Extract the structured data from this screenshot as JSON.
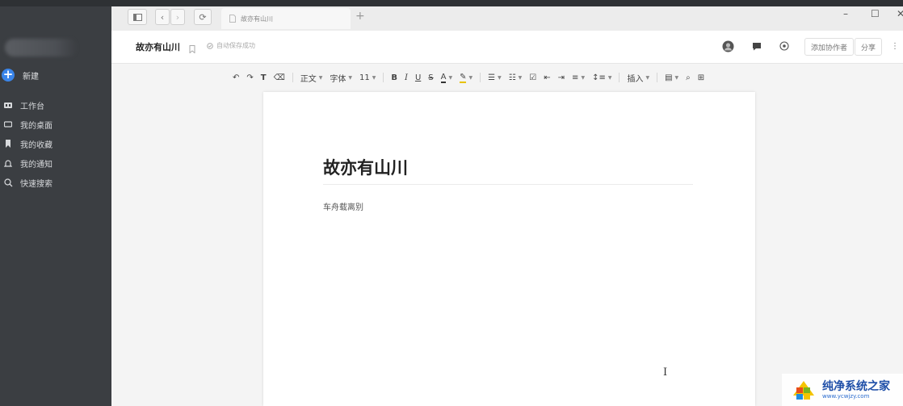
{
  "sidebar": {
    "new_label": "新建",
    "items": [
      {
        "label": "工作台",
        "icon": "dashboard-icon"
      },
      {
        "label": "我的桌面",
        "icon": "desktop-icon"
      },
      {
        "label": "我的收藏",
        "icon": "bookmark-icon"
      },
      {
        "label": "我的通知",
        "icon": "bell-icon"
      },
      {
        "label": "快速搜索",
        "icon": "search-icon"
      }
    ]
  },
  "tabbar": {
    "tab_label": "故亦有山川",
    "add": "+",
    "minimize": "–",
    "maximize": "☐",
    "close": "✕"
  },
  "header": {
    "title": "故亦有山川",
    "autosave": "自动保存成功",
    "add_collaborator": "添加协作者",
    "share": "分享"
  },
  "toolbar": {
    "style": "正文",
    "font": "字体",
    "size": "11",
    "insert": "插入"
  },
  "document": {
    "title": "故亦有山川",
    "body": "车舟载离别"
  },
  "watermark": {
    "main": "纯净系统之家",
    "sub": "www.ycwjzy.com"
  },
  "colors": {
    "accent": "#3a85ea",
    "sidebar_bg": "#3b3e42"
  }
}
